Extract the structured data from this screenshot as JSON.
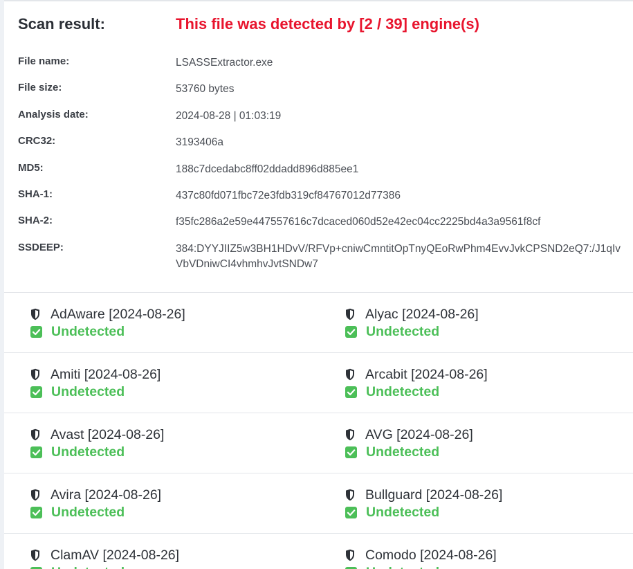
{
  "scan": {
    "label": "Scan result:",
    "verdict": "This file was detected by [2 / 39] engine(s)",
    "verdict_color": "#e8152e"
  },
  "file_info": [
    {
      "key": "File name:",
      "value": "LSASSExtractor.exe"
    },
    {
      "key": "File size:",
      "value": "53760 bytes"
    },
    {
      "key": "Analysis date:",
      "value": "2024-08-28 | 01:03:19"
    },
    {
      "key": "CRC32:",
      "value": "3193406a"
    },
    {
      "key": "MD5:",
      "value": "188c7dcedabc8ff02ddadd896d885ee1"
    },
    {
      "key": "SHA-1:",
      "value": "437c80fd071fbc72e3fdb319cf84767012d77386"
    },
    {
      "key": "SHA-2:",
      "value": "f35fc286a2e59e447557616c7dcaced060d52e42ec04cc2225bd4a3a9561f8cf"
    },
    {
      "key": "SSDEEP:",
      "value": "384:DYYJIIZ5w3BH1HDvV/RFVp+cniwCmntitOpTnyQEoRwPhm4EvvJvkCPSND2eQ7:/J1qIvVbVDniwCI4vhmhvJvtSNDw7"
    }
  ],
  "engines": [
    {
      "name": "AdAware [2024-08-26]",
      "status": "Undetected",
      "icon": "shield-icon"
    },
    {
      "name": "Alyac [2024-08-26]",
      "status": "Undetected",
      "icon": "shield-icon"
    },
    {
      "name": "Amiti [2024-08-26]",
      "status": "Undetected",
      "icon": "shield-icon"
    },
    {
      "name": "Arcabit [2024-08-26]",
      "status": "Undetected",
      "icon": "shield-icon"
    },
    {
      "name": "Avast [2024-08-26]",
      "status": "Undetected",
      "icon": "shield-icon"
    },
    {
      "name": "AVG [2024-08-26]",
      "status": "Undetected",
      "icon": "shield-icon"
    },
    {
      "name": "Avira [2024-08-26]",
      "status": "Undetected",
      "icon": "shield-icon"
    },
    {
      "name": "Bullguard [2024-08-26]",
      "status": "Undetected",
      "icon": "shield-icon"
    },
    {
      "name": "ClamAV [2024-08-26]",
      "status": "Undetected",
      "icon": "shield-icon"
    },
    {
      "name": "Comodo [2024-08-26]",
      "status": "Undetected",
      "icon": "shield-icon"
    }
  ],
  "colors": {
    "undetected": "#4cbf58",
    "text_dark": "#2e3238"
  }
}
